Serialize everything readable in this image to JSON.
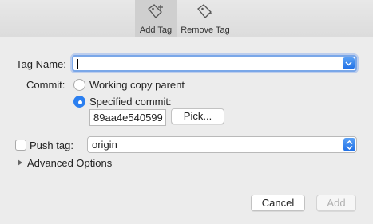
{
  "toolbar": {
    "add_tag_label": "Add Tag",
    "remove_tag_label": "Remove Tag"
  },
  "form": {
    "tag_name_label": "Tag Name:",
    "tag_name_value": "",
    "commit_label": "Commit:",
    "working_copy_parent_label": "Working copy parent",
    "specified_commit_label": "Specified commit:",
    "specified_commit_selected": true,
    "commit_hash_value": "89aa4e540599",
    "pick_button_label": "Pick...",
    "push_tag_label": "Push tag:",
    "push_tag_checked": false,
    "remote_value": "origin",
    "advanced_options_label": "Advanced Options"
  },
  "footer": {
    "cancel_label": "Cancel",
    "add_label": "Add"
  },
  "colors": {
    "accent": "#2b7ff0",
    "toolbar_active": "#cfcfcf",
    "background": "#ececec"
  },
  "icons": {
    "add_tag": "tag-plus-icon",
    "remove_tag": "tag-minus-icon"
  }
}
